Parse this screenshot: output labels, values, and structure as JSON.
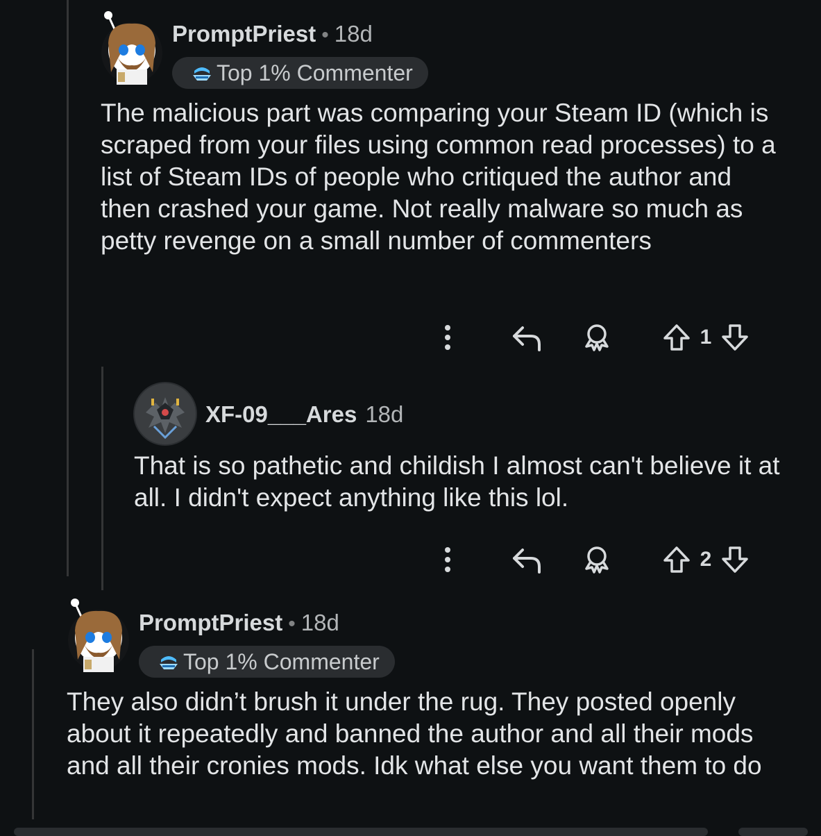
{
  "comments": [
    {
      "username": "PromptPriest",
      "separator": "•",
      "timestamp": "18d",
      "flair": "Top 1% Commenter",
      "body": "The malicious part was comparing your Steam ID (which is scraped from your files using common read processes) to a list of Steam IDs of people who critiqued the author and then crashed your game. Not really malware so much as petty revenge on a small number of commenters",
      "votes": "1",
      "avatar_icon": "bearded-snoo-avatar"
    },
    {
      "username": "XF-09___Ares",
      "timestamp": "18d",
      "body": "That is so pathetic and childish I almost can't believe it at all. I didn't expect anything like this lol.",
      "votes": "2",
      "avatar_icon": "robot-mech-avatar"
    },
    {
      "username": "PromptPriest",
      "separator": "•",
      "timestamp": "18d",
      "flair": "Top 1% Commenter",
      "body": "They also didn’t brush it under the rug. They posted openly about it repeatedly and banned the author and all their mods and all their cronies mods. Idk what else you want them to do",
      "avatar_icon": "bearded-snoo-avatar"
    }
  ],
  "icons": {
    "more": "vertical-dots-icon",
    "reply": "reply-arrow-icon",
    "award": "award-icon",
    "upvote": "upvote-arrow-icon",
    "downvote": "downvote-arrow-icon",
    "flair": "top-commenter-badge-icon"
  },
  "colors": {
    "background": "#0e1113",
    "text": "#e3e5e7",
    "muted": "#b3b6b8",
    "flair_bg": "#2a2d30",
    "flair_icon": "#4fbcff",
    "thread_line": "#343536"
  }
}
